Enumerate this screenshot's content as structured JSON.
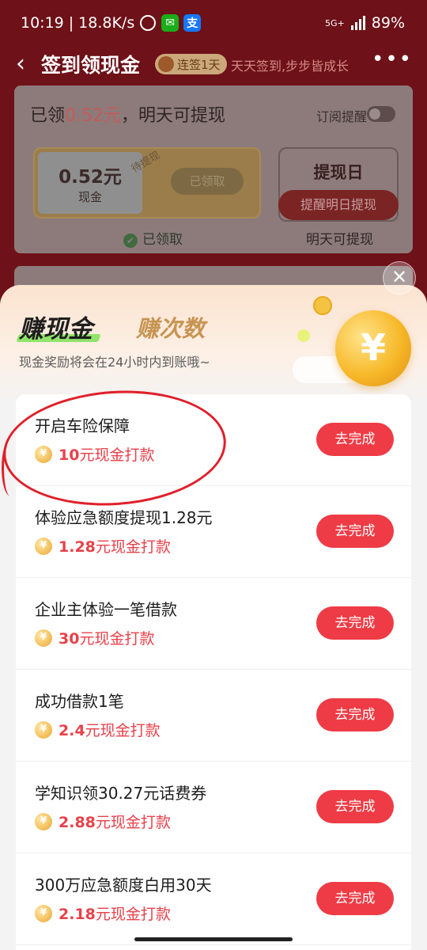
{
  "status": {
    "time": "10:19",
    "speed": "18.8K/s",
    "network": "5G+",
    "battery": "89%"
  },
  "header": {
    "back": "‹",
    "title": "签到领现金",
    "streak": "连签1天",
    "slogan": "天天签到,步步皆成长",
    "more": "•••"
  },
  "summary": {
    "claimed_prefix": "已领",
    "claimed_amount": "0.52元",
    "claimed_suffix": "，明天可提现",
    "subscribe_label": "订阅提醒",
    "cash_value": "0.52元",
    "cash_label": "现金",
    "ribbon": "待提现",
    "withdraw_button": "已领取",
    "day_title": "提现日",
    "remind_button": "提醒明日提现",
    "got_label": "已领取",
    "tomorrow_label": "明天可提现"
  },
  "sheet": {
    "close": "✕",
    "tab_active": "赚现金",
    "tab_inactive": "赚次数",
    "tip": "现金奖励将会在24小时内到账哦~",
    "action_label": "去完成",
    "tasks": [
      {
        "title": "开启车险保障",
        "amount": "10",
        "suffix": "元现金打款"
      },
      {
        "title": "体验应急额度提现1.28元",
        "amount": "1.28",
        "suffix": "元现金打款"
      },
      {
        "title": "企业主体验一笔借款",
        "amount": "30",
        "suffix": "元现金打款"
      },
      {
        "title": "成功借款1笔",
        "amount": "2.4",
        "suffix": "元现金打款"
      },
      {
        "title": "学知识领30.27元话费券",
        "amount": "2.88",
        "suffix": "元现金打款"
      },
      {
        "title": "300万应急额度白用30天",
        "amount": "2.18",
        "suffix": "元现金打款"
      }
    ]
  },
  "colors": {
    "accent": "#ef3b45",
    "reward": "#e8414a",
    "tab_highlight": "#8fe46a",
    "gold": "#c79452"
  }
}
